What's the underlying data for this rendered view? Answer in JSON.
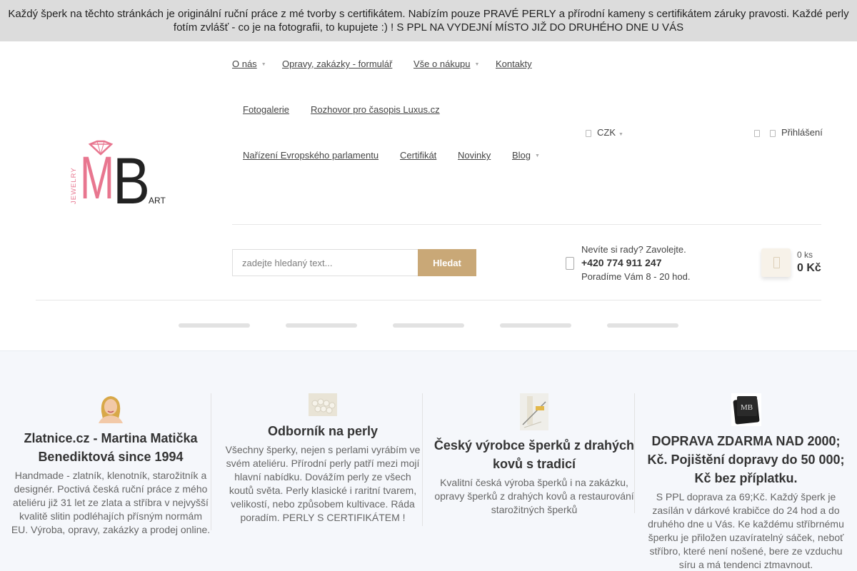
{
  "topbar": {
    "line1": "Každý šperk na těchto stránkách je originální ruční práce z mé tvorby s certifikátem. Nabízím pouze PRAVÉ PERLY a přírodní kameny s certifikátem záruky pravosti. Každé perly",
    "line2": "fotím zvlášť - co je na fotografii, to kupujete :) ! S PPL NA VYDEJNÍ MÍSTO JIŽ DO DRUHÉHO DNE U VÁS"
  },
  "logo": {
    "vertical": "JEWELRY",
    "letters": "MB",
    "suffix": "ART",
    "colors": {
      "pink": "#e8768f",
      "dark": "#222222"
    }
  },
  "nav": {
    "row1": [
      "O nás",
      "Opravy, zakázky - formulář",
      "Vše o nákupu",
      "Kontakty"
    ],
    "row2": [
      "Fotogalerie",
      "Rozhovor pro časopis Luxus.cz"
    ],
    "row3": [
      "Nařízení Evropského parlamentu",
      "Certifikát",
      "Novinky",
      "Blog"
    ]
  },
  "currency": {
    "label": "CZK"
  },
  "login": {
    "label": "Přihlášení"
  },
  "search": {
    "placeholder": "zadejte hledaný text...",
    "button": "Hledat"
  },
  "help": {
    "question": "Nevíte si rady? Zavolejte.",
    "phone": "+420 774 911 247",
    "hours": "Poradíme Vám 8 - 20 hod."
  },
  "cart": {
    "count": "0 ks",
    "total": "0 Kč"
  },
  "features": [
    {
      "title": "Zlatnice.cz - Martina Matička Benediktová since 1994",
      "text": "Handmade - zlatník, klenotník, starožitník a designér. Poctivá česká ruční práce z mého ateliéru již 31 let ze zlata a stříbra v nejvyšší kvalitě slitin podléhajích přísným normám EU. Výroba, opravy, zakázky a prodej online."
    },
    {
      "title": "Odborník na perly",
      "text": "Všechny šperky, nejen s perlami vyrábím ve svém ateliéru. Přírodní perly patří mezi mojí hlavní nabídku. Dovážím perly ze všech koutů světa. Perly klasické i raritní tvarem, velikostí, nebo způsobem kultivace. Ráda poradím. PERLY S CERTIFIKÁTEM !"
    },
    {
      "title": "Český výrobce šperků z drahých kovů s tradicí",
      "text": "Kvalitní česká výroba šperků i na zakázku, opravy šperků z drahých kovů a restaurování starožitných šperků"
    },
    {
      "title": "DOPRAVA ZDARMA NAD 2000; Kč. Pojištění dopravy do 50 000; Kč bez příplatku.",
      "text": "S PPL doprava za 69;Kč. Každý šperk je zasílán v dárkové krabičce  do 24 hod a do druhého dne u Vás. Ke každému stříbrnému šperku je přiložen uzavíratelný sáček, neboť stříbro, které není nošené, bere ze vzduchu síru a má tendenci ztmavnout."
    }
  ],
  "box_label": "MB"
}
